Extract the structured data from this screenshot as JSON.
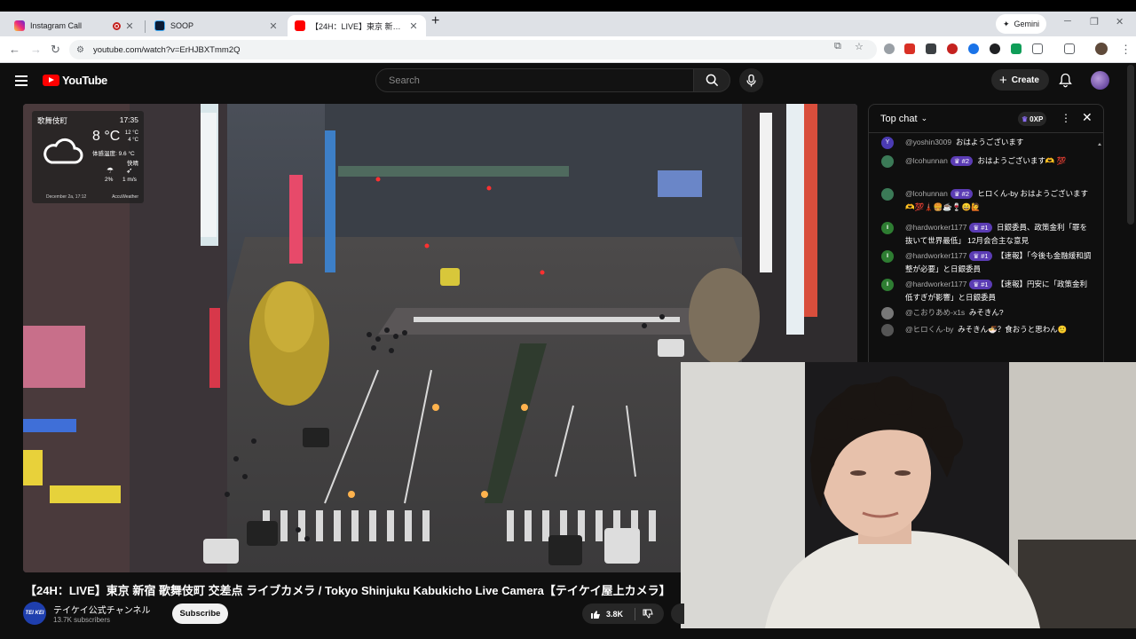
{
  "browser": {
    "tabs": [
      {
        "label": "Instagram Call",
        "favicon": "instagram-icon"
      },
      {
        "label": "SOOP",
        "favicon": "soop-icon"
      },
      {
        "label": "【24H：LIVE】東京 新宿 歌舞伎町",
        "favicon": "youtube-icon"
      }
    ],
    "new_tab": "+",
    "gemini_label": "Gemini",
    "url": "youtube.com/watch?v=ErHJBXTmm2Q"
  },
  "youtube": {
    "logo_text": "YouTube",
    "search_placeholder": "Search",
    "create_label": "Create"
  },
  "video": {
    "weather": {
      "location": "歌舞伎町",
      "time": "17:35",
      "temp": "8 °C",
      "high": "12 °C",
      "low": "4 °C",
      "feels": "体感温度: 9.6 °C",
      "condition": "快晴",
      "rain": "2%",
      "wind": "1 m/s",
      "date": "December 2a, 17:12",
      "brand": "AccuWeather"
    },
    "title": "【24H：LIVE】東京 新宿 歌舞伎町 交差点 ライブカメラ / Tokyo Shinjuku Kabukicho Live Camera【テイケイ屋上カメラ】",
    "channel_logo": "TEI KEI",
    "channel_name": "テイケイ公式チャンネル",
    "subscribers": "13.7K subscribers",
    "subscribe_label": "Subscribe",
    "likes": "3.8K"
  },
  "chat": {
    "header": "Top chat",
    "xp": "0XP",
    "messages": [
      {
        "author": "@yoshin3009",
        "badge": "",
        "text": "おはようございます",
        "avatar_color": "#4b3bb3",
        "avatar_letter": "Y"
      },
      {
        "author": "@lcohunnan",
        "badge": "#2",
        "text": "おはようございます🫶 💯",
        "avatar_color": "#3b7a57",
        "avatar_letter": ""
      },
      {
        "author": "@lcohunnan",
        "badge": "#2",
        "text": "ヒロくん-by おはようございます🫶💯🗼🍔☕🍷😄🙋",
        "avatar_color": "#3b7a57",
        "avatar_letter": ""
      },
      {
        "author": "@hardworker1177",
        "badge": "#1",
        "text": "日銀委員、政策金利「罪を抜いて世界最低」 12月会合主な意見",
        "avatar_color": "#2e7d32",
        "avatar_letter": "ll"
      },
      {
        "author": "@hardworker1177",
        "badge": "#1",
        "text": "【速報】「今後も金融緩和調整が必要」と日銀委員",
        "avatar_color": "#2e7d32",
        "avatar_letter": "ll"
      },
      {
        "author": "@hardworker1177",
        "badge": "#1",
        "text": "【速報】円安に「政策金利低すぎが影響」と日銀委員",
        "avatar_color": "#2e7d32",
        "avatar_letter": "ll"
      },
      {
        "author": "@こおりあめ-x1s",
        "badge": "",
        "text": "みそきん?",
        "avatar_color": "#777",
        "avatar_letter": ""
      },
      {
        "author": "@ヒロくん-by",
        "badge": "",
        "text": "みそきん🍜？食おうと思わん🙂",
        "avatar_color": "#555",
        "avatar_letter": ""
      }
    ]
  },
  "colors": {
    "yt_red": "#ff0000",
    "bg": "#0f0f0f",
    "badge_purple": "#5b3cb4"
  }
}
